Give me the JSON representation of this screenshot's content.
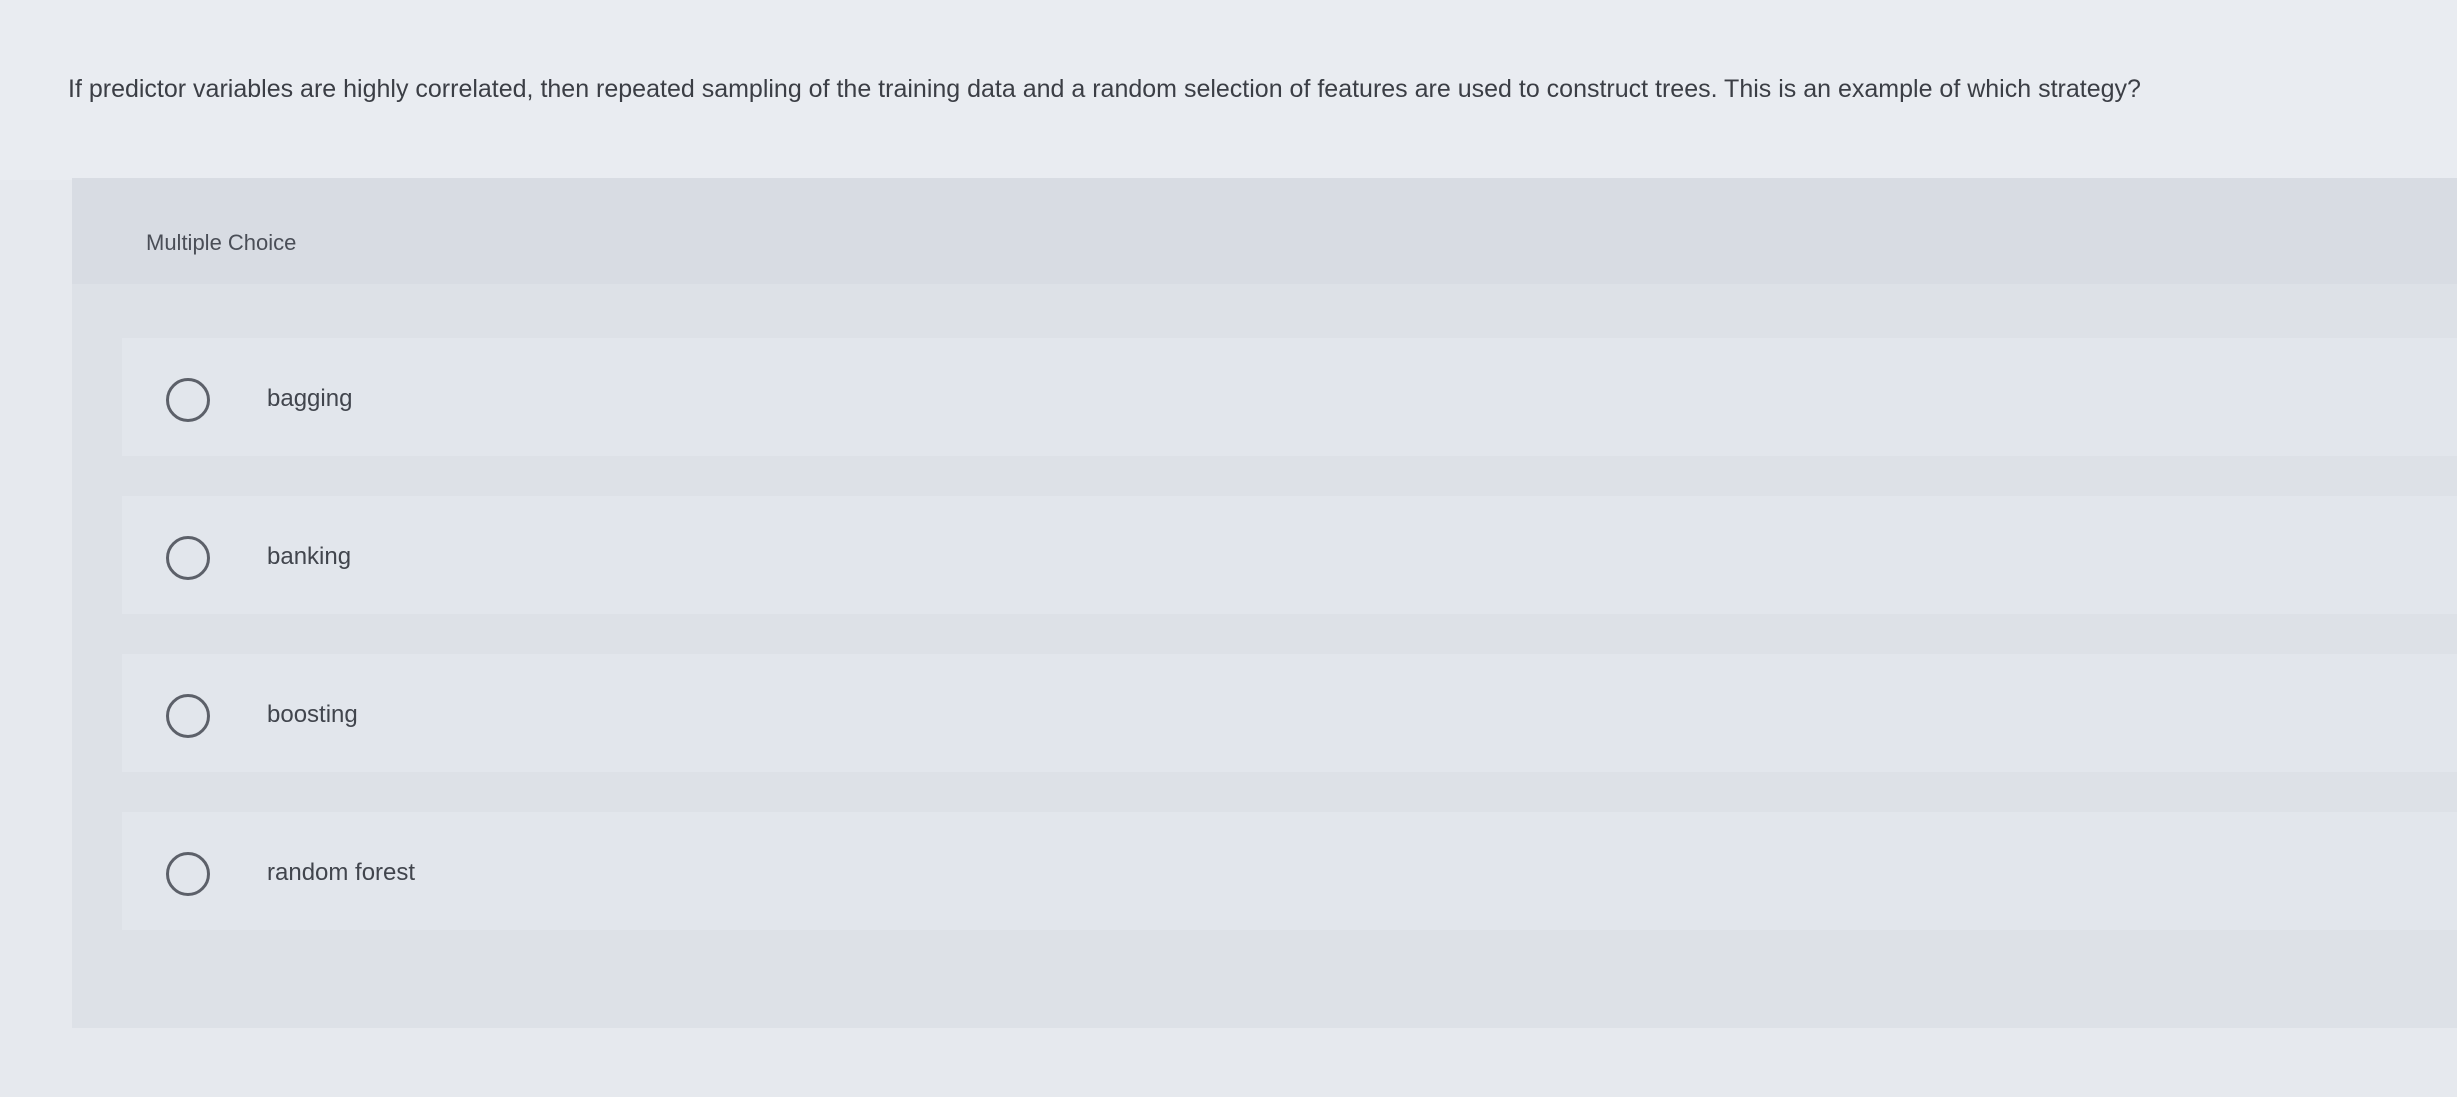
{
  "question": {
    "text": "If predictor variables are highly correlated, then repeated sampling of the training data and a random selection of features are used to construct trees. This is an example of which strategy?"
  },
  "multiple_choice": {
    "header_label": "Multiple Choice",
    "options": [
      {
        "label": "bagging",
        "selected": false
      },
      {
        "label": "banking",
        "selected": false
      },
      {
        "label": "boosting",
        "selected": false
      },
      {
        "label": "random forest",
        "selected": false
      }
    ]
  }
}
